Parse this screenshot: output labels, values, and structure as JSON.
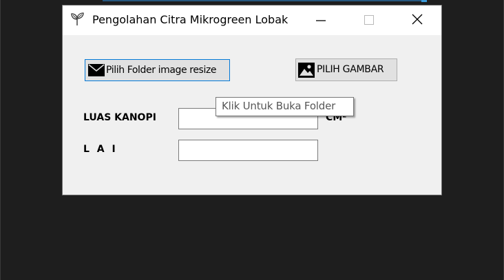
{
  "window": {
    "title": "Pengolahan Citra Mikrogreen Lobak",
    "app_icon": "sprout-icon",
    "controls": {
      "minimize_icon": "minimize-icon",
      "maximize_icon": "maximize-icon",
      "close_icon": "close-icon"
    }
  },
  "toolbar": {
    "folder_button_label": "Pilih Folder image resize",
    "folder_button_icon": "envelope-icon",
    "image_button_label": "PILIH GAMBAR",
    "image_button_icon": "image-icon"
  },
  "fields": {
    "luas_label": "LUAS KANOPI",
    "luas_value": "",
    "unit_label": "CM²",
    "lai_label": "L A I",
    "lai_value": ""
  },
  "tooltip": {
    "text": "Klik Untuk Buka Folder"
  },
  "colors": {
    "window_bg": "#f0f0f0",
    "titlebar_bg": "#ffffff",
    "desktop_bg": "#1e1e1e",
    "focus_border": "#0078d7"
  }
}
